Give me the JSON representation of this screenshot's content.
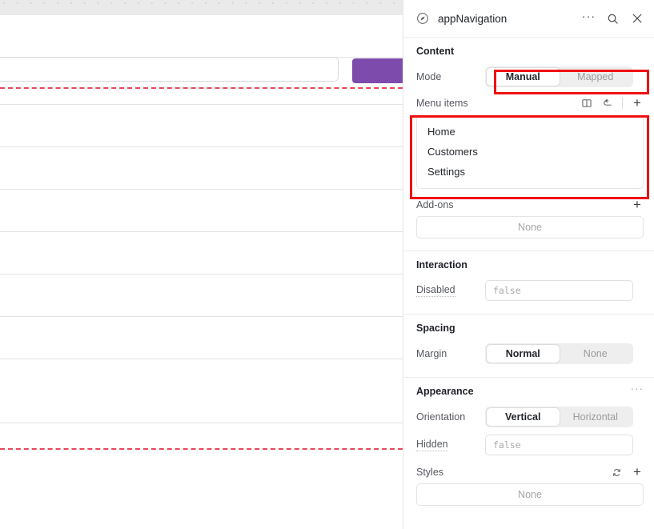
{
  "canvas": {
    "name": "editor-canvas",
    "input_field": "",
    "button_label": "",
    "button_color": "#7d4bab",
    "guide_color": "#e8485a"
  },
  "panel": {
    "header": {
      "icon": "compass-icon",
      "title": "appNavigation",
      "actions": [
        {
          "icon": "more-horizontal-icon",
          "name": "panel-more-button"
        },
        {
          "icon": "search-icon",
          "name": "panel-search-button"
        },
        {
          "icon": "close-icon",
          "name": "panel-close-button"
        }
      ]
    },
    "sections": {
      "content": {
        "title": "Content",
        "mode": {
          "label": "Mode",
          "options": [
            "Manual",
            "Mapped"
          ],
          "selected": "Manual"
        },
        "menu_items": {
          "label": "Menu items",
          "actions": [
            {
              "icon": "book-icon",
              "name": "menu-items-docs-button"
            },
            {
              "icon": "reset-icon",
              "name": "menu-items-reset-button"
            },
            {
              "icon": "plus-icon",
              "name": "menu-items-add-button"
            }
          ],
          "items": [
            "Home",
            "Customers",
            "Settings"
          ]
        },
        "add_ons": {
          "label": "Add-ons",
          "add_icon": "plus-icon",
          "value": "None"
        }
      },
      "interaction": {
        "title": "Interaction",
        "disabled": {
          "label": "Disabled",
          "value": "false"
        }
      },
      "spacing": {
        "title": "Spacing",
        "margin": {
          "label": "Margin",
          "options": [
            "Normal",
            "None"
          ],
          "selected": "Normal"
        }
      },
      "appearance": {
        "title": "Appearance",
        "more_icon": "more-horizontal-icon",
        "orientation": {
          "label": "Orientation",
          "options": [
            "Vertical",
            "Horizontal"
          ],
          "selected": "Vertical"
        },
        "hidden": {
          "label": "Hidden",
          "value": "false"
        },
        "styles": {
          "label": "Styles",
          "actions": [
            {
              "icon": "refresh-icon",
              "name": "styles-reset-button"
            },
            {
              "icon": "plus-icon",
              "name": "styles-add-button"
            }
          ],
          "value": "None"
        }
      }
    }
  },
  "annotations": {
    "color": "#f01111",
    "boxes": [
      "mode-control",
      "menu-items-list"
    ]
  }
}
